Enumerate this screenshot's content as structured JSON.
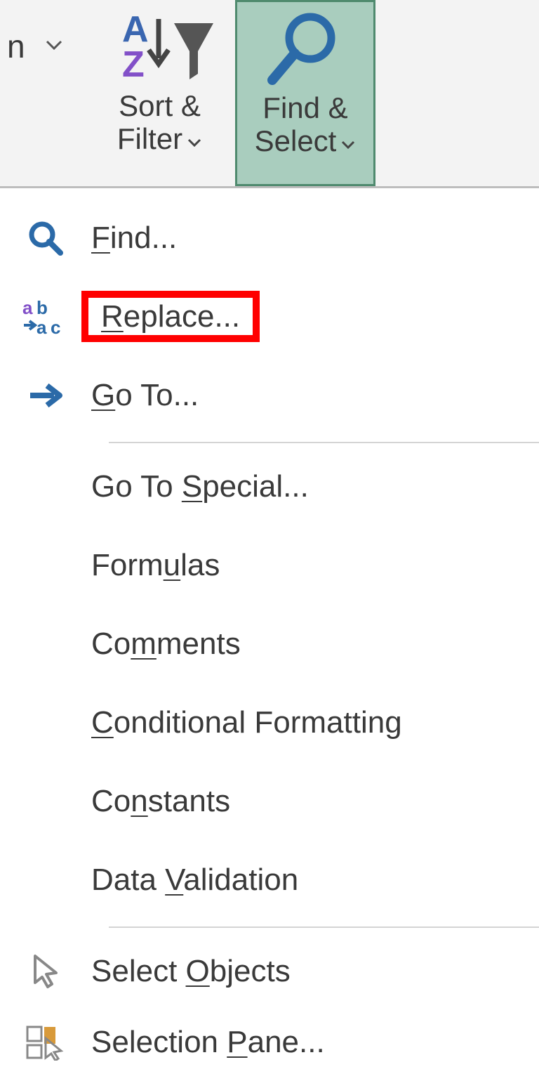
{
  "ribbon": {
    "left_fragment_letter": "n",
    "sort_filter": {
      "line1": "Sort &",
      "line2": "Filter"
    },
    "find_select": {
      "line1": "Find &",
      "line2": "Select"
    }
  },
  "menu": {
    "find": {
      "pre": "",
      "hot": "F",
      "post": "ind..."
    },
    "replace": {
      "pre": "",
      "hot": "R",
      "post": "eplace..."
    },
    "goto": {
      "pre": "",
      "hot": "G",
      "post": "o To..."
    },
    "go_to_special": {
      "pre": "Go To ",
      "hot": "S",
      "post": "pecial..."
    },
    "formulas": {
      "pre": "Form",
      "hot": "u",
      "post": "las"
    },
    "comments": {
      "pre": "Co",
      "hot": "m",
      "post": "ments"
    },
    "conditional_formatting": {
      "pre": "",
      "hot": "C",
      "post": "onditional Formatting"
    },
    "constants": {
      "pre": "Co",
      "hot": "n",
      "post": "stants"
    },
    "data_validation": {
      "pre": "Data ",
      "hot": "V",
      "post": "alidation"
    },
    "select_objects": {
      "pre": "Select ",
      "hot": "O",
      "post": "bjects"
    },
    "selection_pane": {
      "pre": "Selection ",
      "hot": "P",
      "post": "ane..."
    }
  },
  "highlighted": "replace"
}
